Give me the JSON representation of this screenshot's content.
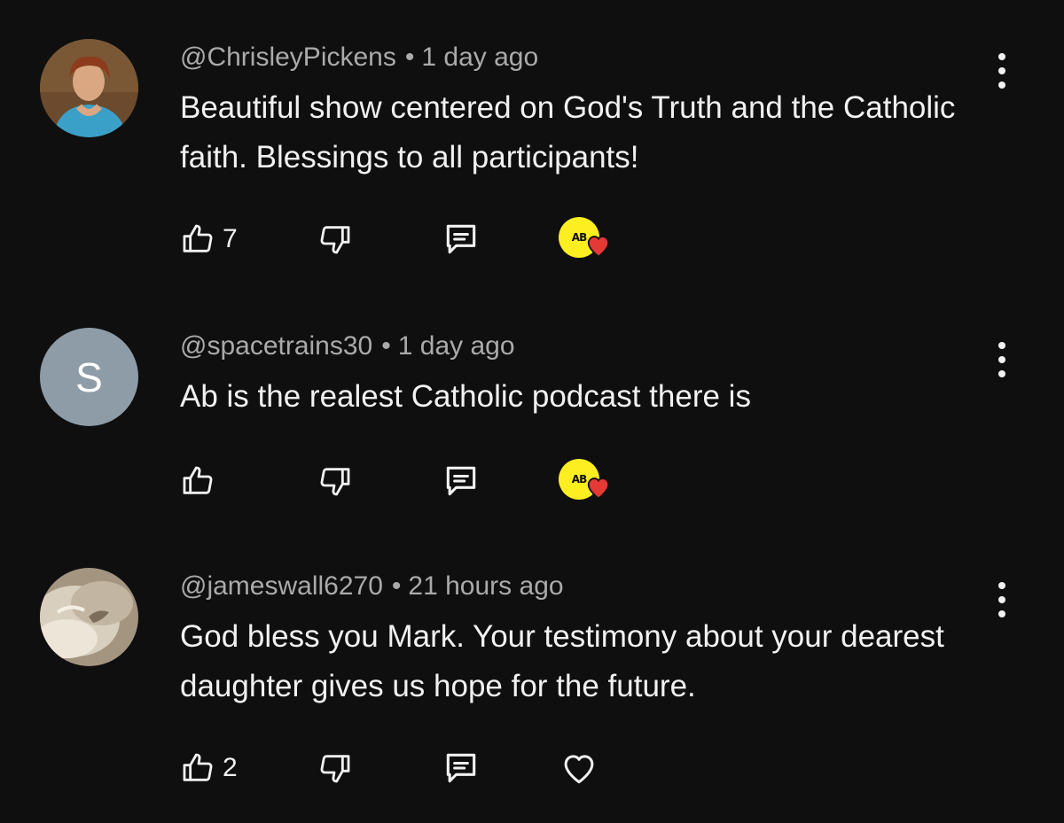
{
  "comments": [
    {
      "handle": "@ChrisleyPickens",
      "separator": "•",
      "time": "1 day ago",
      "text": "Beautiful show centered on God's Truth and the Catholic faith.  Blessings to all participants!",
      "likes": "7",
      "avatar": "photo-woman",
      "creator_heart": true
    },
    {
      "handle": "@spacetrains30",
      "separator": "•",
      "time": "1 day ago",
      "text": "Ab is the realest Catholic podcast there is",
      "likes": "",
      "avatar_letter": "S",
      "creator_heart": true
    },
    {
      "handle": "@jameswall6270",
      "separator": "•",
      "time": "21 hours ago",
      "text": "God bless you Mark. Your testimony about your dearest daughter gives us hope for the future.",
      "likes": "2",
      "avatar": "photo-fur",
      "creator_heart": false
    }
  ],
  "creator_badge_text": "AB",
  "icons": {
    "like": "thumbs-up-icon",
    "dislike": "thumbs-down-icon",
    "reply": "reply-comment-icon",
    "heart": "heart-outline-icon",
    "more": "more-vert-icon"
  },
  "colors": {
    "background": "#0f0f0f",
    "meta": "#aaaaaa",
    "text": "#f1f1f1",
    "creator_badge": "#fcee21",
    "heart": "#e53935"
  }
}
